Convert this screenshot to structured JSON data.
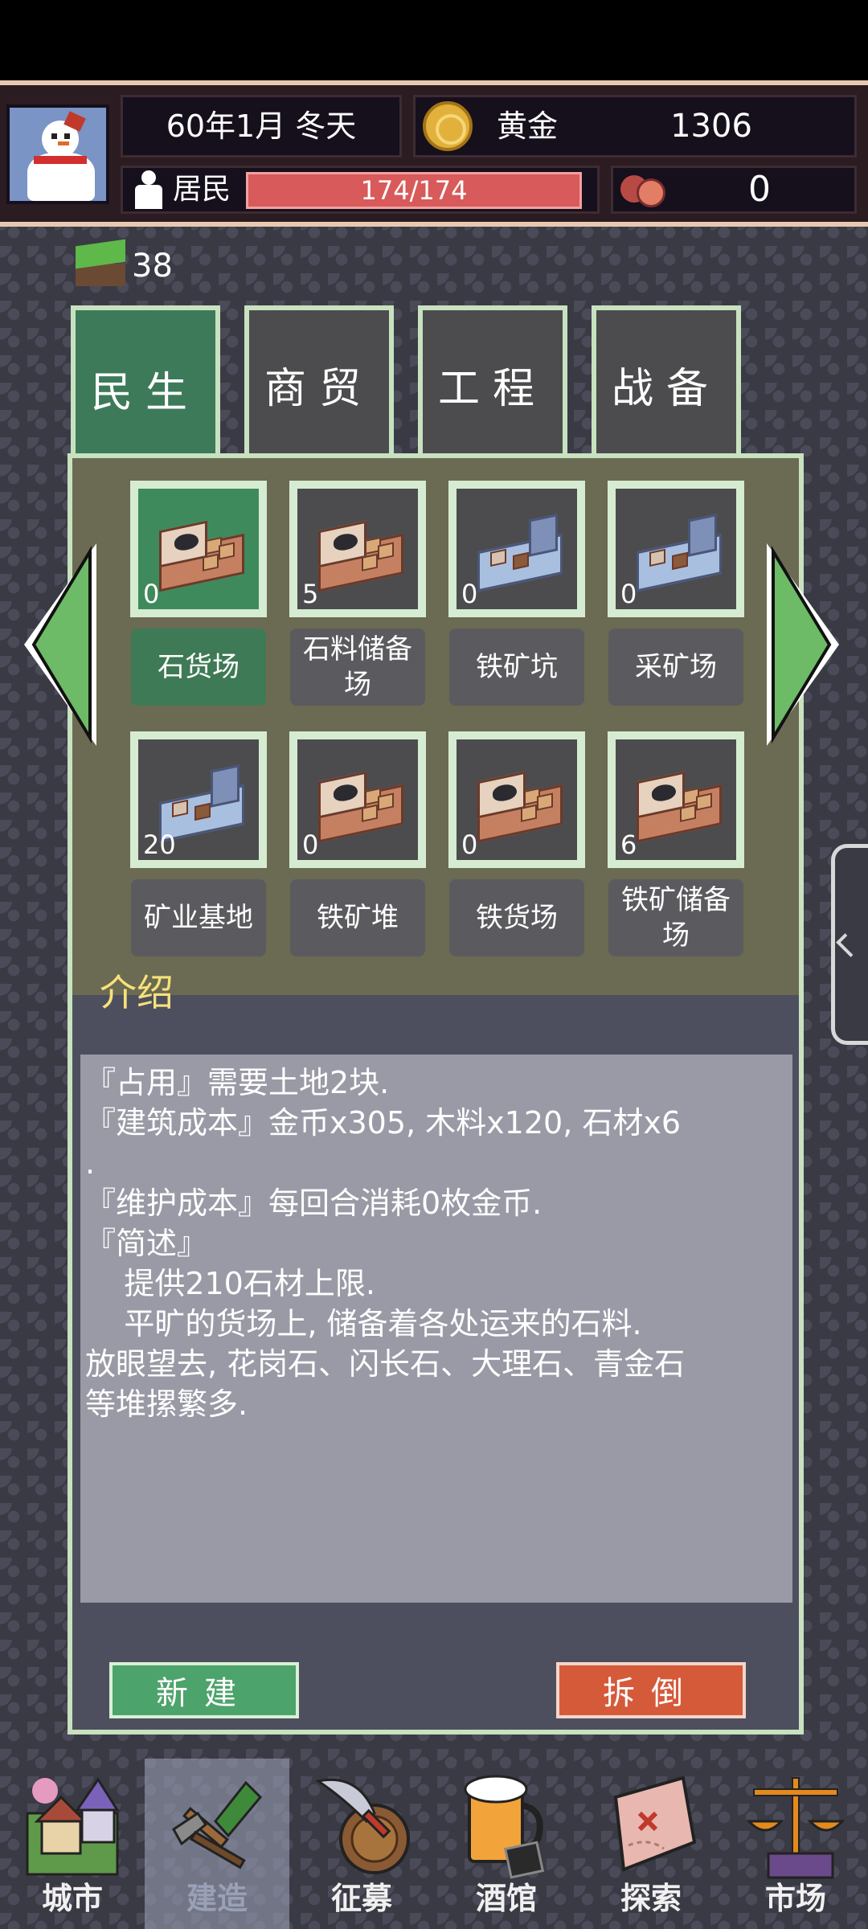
{
  "header": {
    "date": "60年1月 冬天",
    "gold_label": "黄金",
    "gold_value": "1306",
    "pop_label": "居民",
    "pop_value": "174/174",
    "pop_fraction": 1.0,
    "meat_value": "0",
    "avatar_icon": "snowman-avatar",
    "gold_icon": "gold-coin-icon",
    "pop_icon": "resident-icon",
    "meat_icon": "meat-icon"
  },
  "land": {
    "icon": "land-block-icon",
    "value": "38"
  },
  "tabs": [
    {
      "label": "民生",
      "active": true
    },
    {
      "label": "商贸",
      "active": false
    },
    {
      "label": "工程",
      "active": false
    },
    {
      "label": "战备",
      "active": false
    }
  ],
  "buildings": [
    {
      "name": "石货场",
      "count": "0",
      "style": "wood",
      "selected": true
    },
    {
      "name": "石料储备场",
      "count": "5",
      "style": "wood",
      "selected": false
    },
    {
      "name": "铁矿坑",
      "count": "0",
      "style": "ice",
      "selected": false
    },
    {
      "name": "采矿场",
      "count": "0",
      "style": "ice",
      "selected": false
    },
    {
      "name": "矿业基地",
      "count": "20",
      "style": "ice",
      "selected": false
    },
    {
      "name": "铁矿堆",
      "count": "0",
      "style": "wood",
      "selected": false
    },
    {
      "name": "铁货场",
      "count": "0",
      "style": "wood",
      "selected": false
    },
    {
      "name": "铁矿储备场",
      "count": "6",
      "style": "wood",
      "selected": false
    }
  ],
  "intro": {
    "title": "介绍",
    "lines": [
      "『占用』需要土地2块.",
      "『建筑成本』金币x305, 木料x120, 石材x6",
      ".",
      "『维护成本』每回合消耗0枚金币.",
      "",
      "『简述』",
      "    提供210石材上限.",
      "    平旷的货场上, 储备着各处运来的石料.",
      "放眼望去, 花岗石、闪长石、大理石、青金石",
      "等堆摞繁多."
    ]
  },
  "buttons": {
    "build": "新建",
    "demolish": "拆倒"
  },
  "colors": {
    "accent_green": "#3e7a55",
    "panel": "#6b6a52",
    "gold_text": "#f6e27a",
    "danger": "#d45a3a"
  },
  "nav": [
    {
      "label": "城市",
      "icon": "city-icon",
      "active": false
    },
    {
      "label": "建造",
      "icon": "shovel-icon",
      "active": true
    },
    {
      "label": "征募",
      "icon": "sword-shield-icon",
      "active": false
    },
    {
      "label": "酒馆",
      "icon": "beer-mug-icon",
      "active": false
    },
    {
      "label": "探索",
      "icon": "map-icon",
      "active": false
    },
    {
      "label": "市场",
      "icon": "scales-icon",
      "active": false
    }
  ]
}
